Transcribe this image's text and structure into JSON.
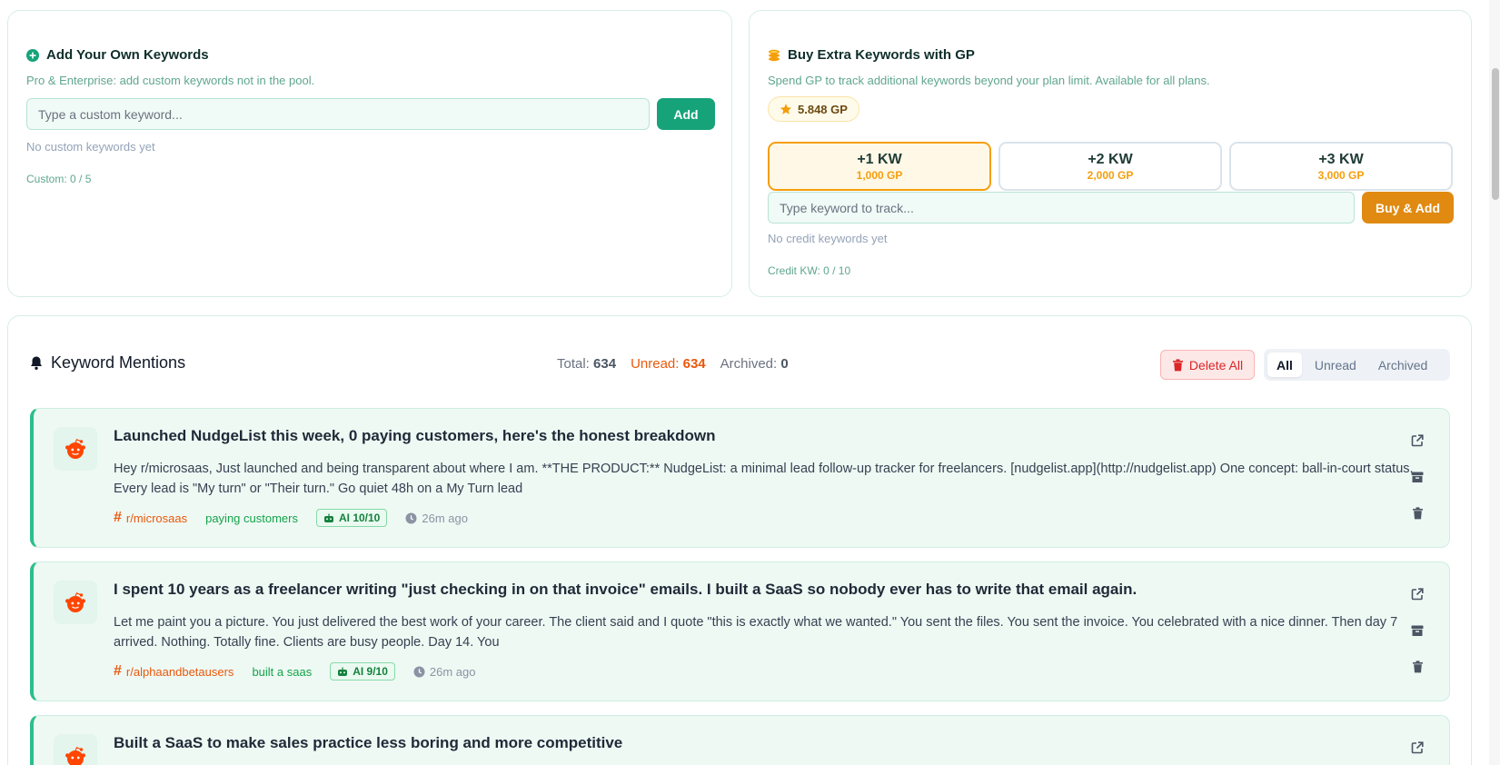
{
  "custom_card": {
    "title": "Add Your Own Keywords",
    "subtitle": "Pro & Enterprise: add custom keywords not in the pool.",
    "input_placeholder": "Type a custom keyword...",
    "add_label": "Add",
    "empty_text": "No custom keywords yet",
    "counter": "Custom: 0 / 5"
  },
  "gp_card": {
    "title": "Buy Extra Keywords with GP",
    "subtitle": "Spend GP to track additional keywords beyond your plan limit. Available for all plans.",
    "balance": "5.848 GP",
    "options": [
      {
        "kw": "+1 KW",
        "gp": "1,000 GP",
        "selected": true
      },
      {
        "kw": "+2 KW",
        "gp": "2,000 GP",
        "selected": false
      },
      {
        "kw": "+3 KW",
        "gp": "3,000 GP",
        "selected": false
      }
    ],
    "input_placeholder": "Type keyword to track...",
    "buy_label": "Buy & Add",
    "empty_text": "No credit keywords yet",
    "counter": "Credit KW: 0 / 10"
  },
  "mentions": {
    "title": "Keyword Mentions",
    "stats": {
      "total_label": "Total:",
      "total": "634",
      "unread_label": "Unread:",
      "unread": "634",
      "archived_label": "Archived:",
      "archived": "0"
    },
    "delete_all_label": "Delete All",
    "filters": [
      "All",
      "Unread",
      "Archived"
    ],
    "active_filter": "All"
  },
  "posts": [
    {
      "title": "Launched NudgeList this week, 0 paying customers, here's the honest breakdown",
      "body": "Hey r/microsaas, Just launched and being transparent about where I am. **THE PRODUCT:** NudgeList: a minimal lead follow-up tracker for freelancers. [nudgelist.app](http://nudgelist.app) One concept: ball-in-court status. Every lead is \"My turn\" or \"Their turn.\" Go quiet 48h on a My Turn lead",
      "subreddit": "r/microsaas",
      "keyword": "paying customers",
      "ai_score": "AI 10/10",
      "time": "26m ago"
    },
    {
      "title": "I spent 10 years as a freelancer writing \"just checking in on that invoice\" emails. I built a SaaS so nobody ever has to write that email again.",
      "body": "Let me paint you a picture. You just delivered the best work of your career. The client said and I quote \"this is exactly what we wanted.\" You sent the files. You sent the invoice. You celebrated with a nice dinner. Then day 7 arrived. Nothing. Totally fine. Clients are busy people. Day 14. You",
      "subreddit": "r/alphaandbetausers",
      "keyword": "built a saas",
      "ai_score": "AI 9/10",
      "time": "26m ago"
    },
    {
      "title": "Built a SaaS to make sales practice less boring and more competitive"
    }
  ],
  "colors": {
    "brand_green": "#16a37a",
    "gp_orange": "#e08a12",
    "unread_orange": "#ea580c",
    "danger_red": "#dc2626"
  }
}
